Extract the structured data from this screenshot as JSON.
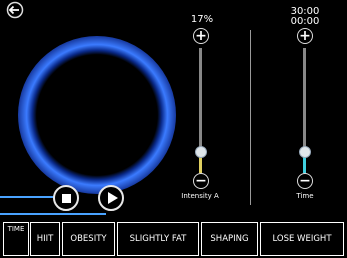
{
  "intensity": {
    "value_label": "17%",
    "caption": "Intensity A",
    "level_percent": 17,
    "fill_color": "#e0d060"
  },
  "time": {
    "value_line1": "30:00",
    "value_line2": "00:00",
    "caption": "Time",
    "level_percent": 17,
    "fill_color": "#40d0e0"
  },
  "modes": [
    "TIME",
    "HIIT",
    "OBESITY",
    "SLIGHTLY FAT",
    "SHAPING",
    "LOSE WEIGHT"
  ],
  "colors": {
    "accent": "#3b7bff",
    "background": "#000000"
  },
  "icons": {
    "back": "back-arrow-icon",
    "stop": "stop-icon",
    "play": "play-icon",
    "plus": "plus-icon",
    "minus": "minus-icon"
  }
}
